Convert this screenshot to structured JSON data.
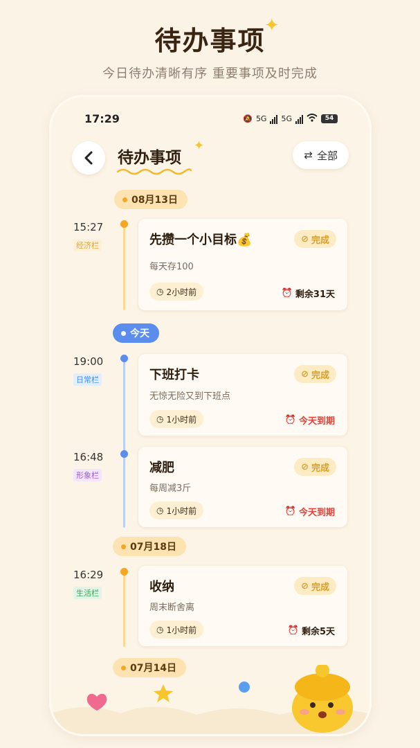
{
  "hero": {
    "title": "待办事项",
    "subtitle": "今日待办清晰有序 重要事项及时完成"
  },
  "status_bar": {
    "time": "17:29",
    "network1": "5G",
    "network2": "5G",
    "battery": "54"
  },
  "nav": {
    "title": "待办事项",
    "filter_label": "全部"
  },
  "groups": [
    {
      "date": "08月13日",
      "today": false
    },
    {
      "date": "今天",
      "today": true
    },
    {
      "date": "07月18日",
      "today": false
    },
    {
      "date": "07月14日",
      "today": false
    }
  ],
  "items": [
    {
      "time": "15:27",
      "tag": "经济栏",
      "title": "先攒一个小目标💰",
      "desc": "每天存100",
      "ago": "2小时前",
      "done_label": "完成",
      "remain": "剩余31天",
      "remain_status": "normal"
    },
    {
      "time": "19:00",
      "tag": "日常栏",
      "title": "下班打卡",
      "desc": "无惊无险又到下班点",
      "ago": "1小时前",
      "done_label": "完成",
      "remain": "今天到期",
      "remain_status": "warn"
    },
    {
      "time": "16:48",
      "tag": "形象栏",
      "title": "减肥",
      "desc": "每周减3斤",
      "ago": "1小时前",
      "done_label": "完成",
      "remain": "今天到期",
      "remain_status": "warn"
    },
    {
      "time": "16:29",
      "tag": "生活栏",
      "title": "收纳",
      "desc": "周末断舍离",
      "ago": "1小时前",
      "done_label": "完成",
      "remain": "剩余5天",
      "remain_status": "normal"
    }
  ],
  "colors": {
    "background": "#fbf3e6",
    "accent_yellow": "#f5a623",
    "today_blue": "#5b8def",
    "warn_red": "#e0433a",
    "tag_economy": "#e8a43a",
    "tag_daily": "#4a8ee6",
    "tag_image": "#a35ad6",
    "tag_life": "#3aa85a"
  },
  "icons": [
    "back-chevron-icon",
    "swap-arrows-icon",
    "check-circle-icon",
    "clock-icon",
    "alarm-icon",
    "sparkle-icon",
    "heart-icon",
    "star-icon",
    "mascot-icon"
  ]
}
